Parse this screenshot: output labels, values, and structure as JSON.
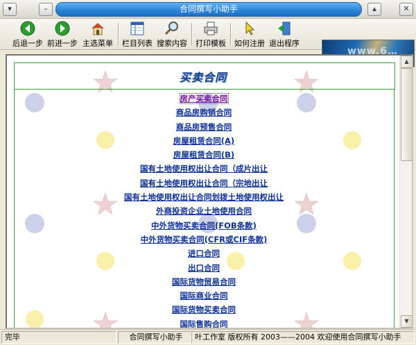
{
  "window": {
    "title": "合同撰写小助手"
  },
  "toolbar": {
    "items": [
      {
        "label": "后退一步",
        "icon": "back-arrow-icon"
      },
      {
        "label": "前进一步",
        "icon": "forward-arrow-icon"
      },
      {
        "label": "主选菜单",
        "icon": "home-icon"
      },
      {
        "label": "栏目列表",
        "icon": "list-icon"
      },
      {
        "label": "搜索内容",
        "icon": "magnifier-icon"
      },
      {
        "label": "打印模板",
        "icon": "printer-icon"
      },
      {
        "label": "如何注册",
        "icon": "pointer-icon"
      },
      {
        "label": "退出程序",
        "icon": "exit-icon"
      }
    ],
    "banner_text": "www.6…"
  },
  "content": {
    "heading": "买卖合同",
    "links": [
      "房产买卖合同",
      "商品房购销合同",
      "商品房预售合同",
      "房屋租赁合同(A)",
      "房屋租赁合同(B)",
      "国有土地使用权出让合同（成片出让",
      "国有土地使用权出让合同（宗地出让",
      "国有土地使用权出让合同划拨土地使用权出让",
      "外商投资企业土地使用合同",
      "中外货物买卖合同(FOB条款)",
      "中外货物买卖合同(CFR或CIF条款)",
      "进口合同",
      "出口合同",
      "国际货物贸易合同",
      "国际商业合同",
      "国际货物买卖合同",
      "国际售购合同"
    ]
  },
  "status": {
    "left": "完毕",
    "middle": "合同撰写小助手",
    "right": "叶工作室 版权所有 2003——2004 欢迎使用合同撰写小助手"
  },
  "colors": {
    "title_blue": "#2a83d6",
    "link_blue": "#0b2f96",
    "link_visited": "#7b0da0",
    "frame_green": "#3b9a3b"
  }
}
